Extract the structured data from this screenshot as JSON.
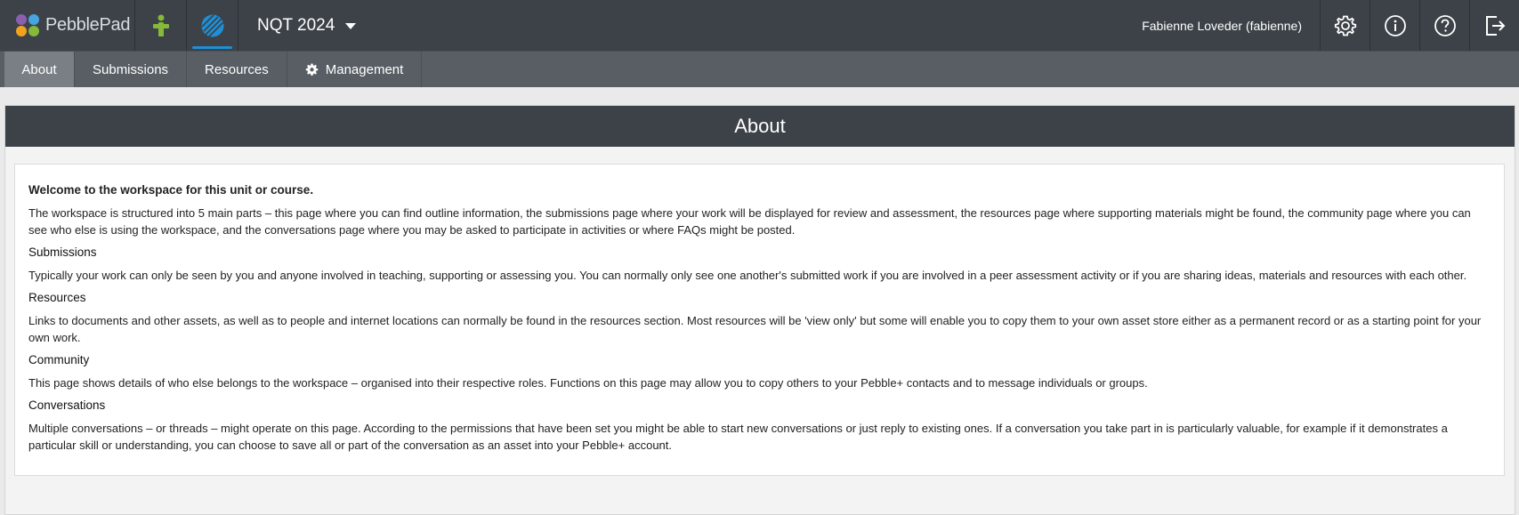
{
  "app": {
    "name": "PebblePad",
    "logo_colors": [
      "#8b5fb0",
      "#45a5de",
      "#f2a21b",
      "#86b93a"
    ]
  },
  "header": {
    "workspace_title": "NQT 2024",
    "user_name": "Fabienne Loveder (fabienne)",
    "icons": [
      "figure-icon",
      "workspace-globe-icon",
      "settings-gear-icon",
      "info-icon",
      "help-icon",
      "logout-icon"
    ]
  },
  "tabs": [
    {
      "label": "About",
      "active": true
    },
    {
      "label": "Submissions",
      "active": false
    },
    {
      "label": "Resources",
      "active": false
    },
    {
      "label": "Management",
      "active": false,
      "icon": "gear-icon"
    }
  ],
  "panel": {
    "title": "About"
  },
  "about": {
    "welcome": "Welcome to the workspace for this unit or course.",
    "intro": "The workspace is structured into 5 main parts – this page where you can find outline information, the submissions page where your work will be displayed for review and assessment, the resources page where supporting materials might be found, the community page where you can see who else is using the workspace, and the conversations page where you may be asked to participate in activities or where FAQs might be posted.",
    "sections": [
      {
        "heading": "Submissions",
        "text": "Typically your work can only be seen by you and anyone involved in teaching, supporting or assessing you. You can normally only see one another's submitted work if you are involved in a peer assessment activity or if you are sharing ideas, materials and resources with each other."
      },
      {
        "heading": "Resources",
        "text": "Links to documents and other assets, as well as to people and internet locations can normally be found in the resources section. Most resources will be 'view only' but some will enable you to copy them to your own asset store either as a permanent record or as a starting point for your own work."
      },
      {
        "heading": "Community",
        "text": "This page shows details of who else belongs to the workspace – organised into their respective roles. Functions on this page may allow you to copy others to your Pebble+ contacts and to message individuals or groups."
      },
      {
        "heading": "Conversations",
        "text": "Multiple conversations – or threads – might operate on this page. According to the permissions that have been set you might be able to start new conversations or just reply to existing ones. If a conversation you take part in is particularly valuable, for example if it demonstrates a particular skill or understanding, you can choose to save all or part of the conversation as an asset into your Pebble+ account."
      }
    ]
  }
}
